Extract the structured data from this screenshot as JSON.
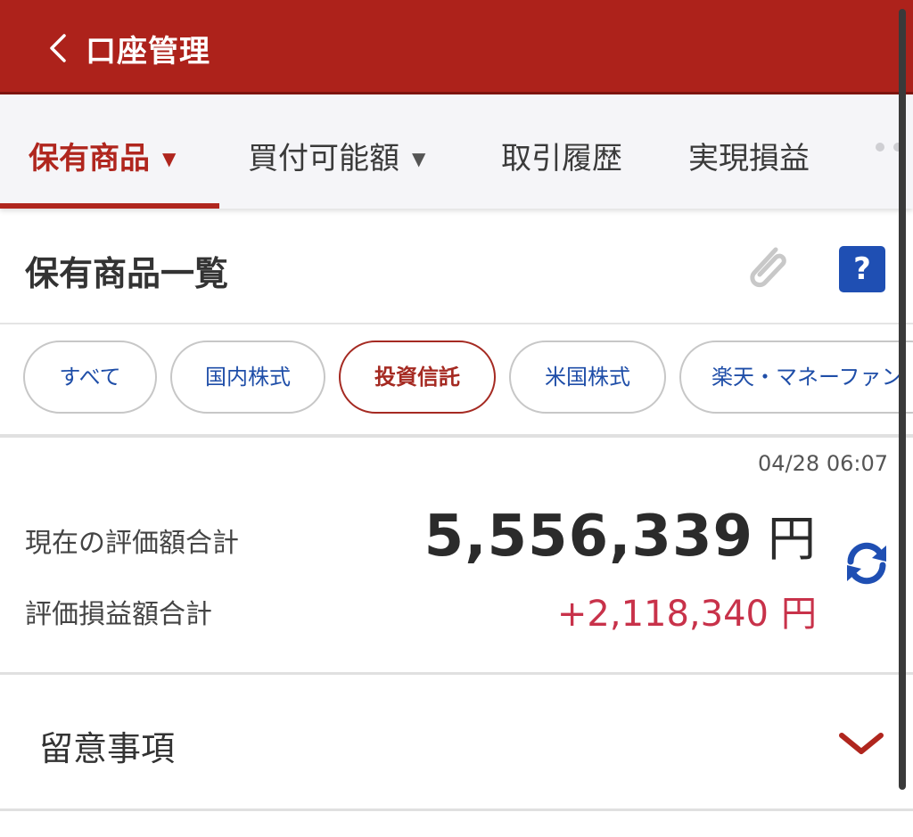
{
  "header": {
    "title": "口座管理",
    "back_icon": "chevron-left-icon",
    "bg_color": "#ad221b"
  },
  "tabs": [
    {
      "label": "保有商品",
      "active": true,
      "has_caret": true
    },
    {
      "label": "買付可能額",
      "active": false,
      "has_caret": true
    },
    {
      "label": "取引履歴",
      "active": false,
      "has_caret": false
    },
    {
      "label": "実現損益",
      "active": false,
      "has_caret": false
    }
  ],
  "tab_caret": "▼",
  "section": {
    "title": "保有商品一覧",
    "clip_icon": "paperclip-icon",
    "help_label": "?"
  },
  "filters": [
    {
      "label": "すべて",
      "active": false
    },
    {
      "label": "国内株式",
      "active": false
    },
    {
      "label": "投資信託",
      "active": true
    },
    {
      "label": "米国株式",
      "active": false
    },
    {
      "label": "楽天・マネーファン",
      "active": false
    }
  ],
  "summary": {
    "timestamp": "04/28 06:07",
    "total_label": "現在の評価額合計",
    "total_value": "5,556,339",
    "total_unit": "円",
    "pl_label": "評価損益額合計",
    "pl_value": "+2,118,340",
    "pl_unit": "円",
    "pl_color": "#c8324a",
    "refresh_icon": "refresh-icon"
  },
  "notes": {
    "label": "留意事項",
    "chevron_icon": "chevron-down-icon"
  },
  "colors": {
    "accent": "#b0261e",
    "link_blue": "#1f4ea8",
    "help_blue": "#1f4fb3"
  }
}
